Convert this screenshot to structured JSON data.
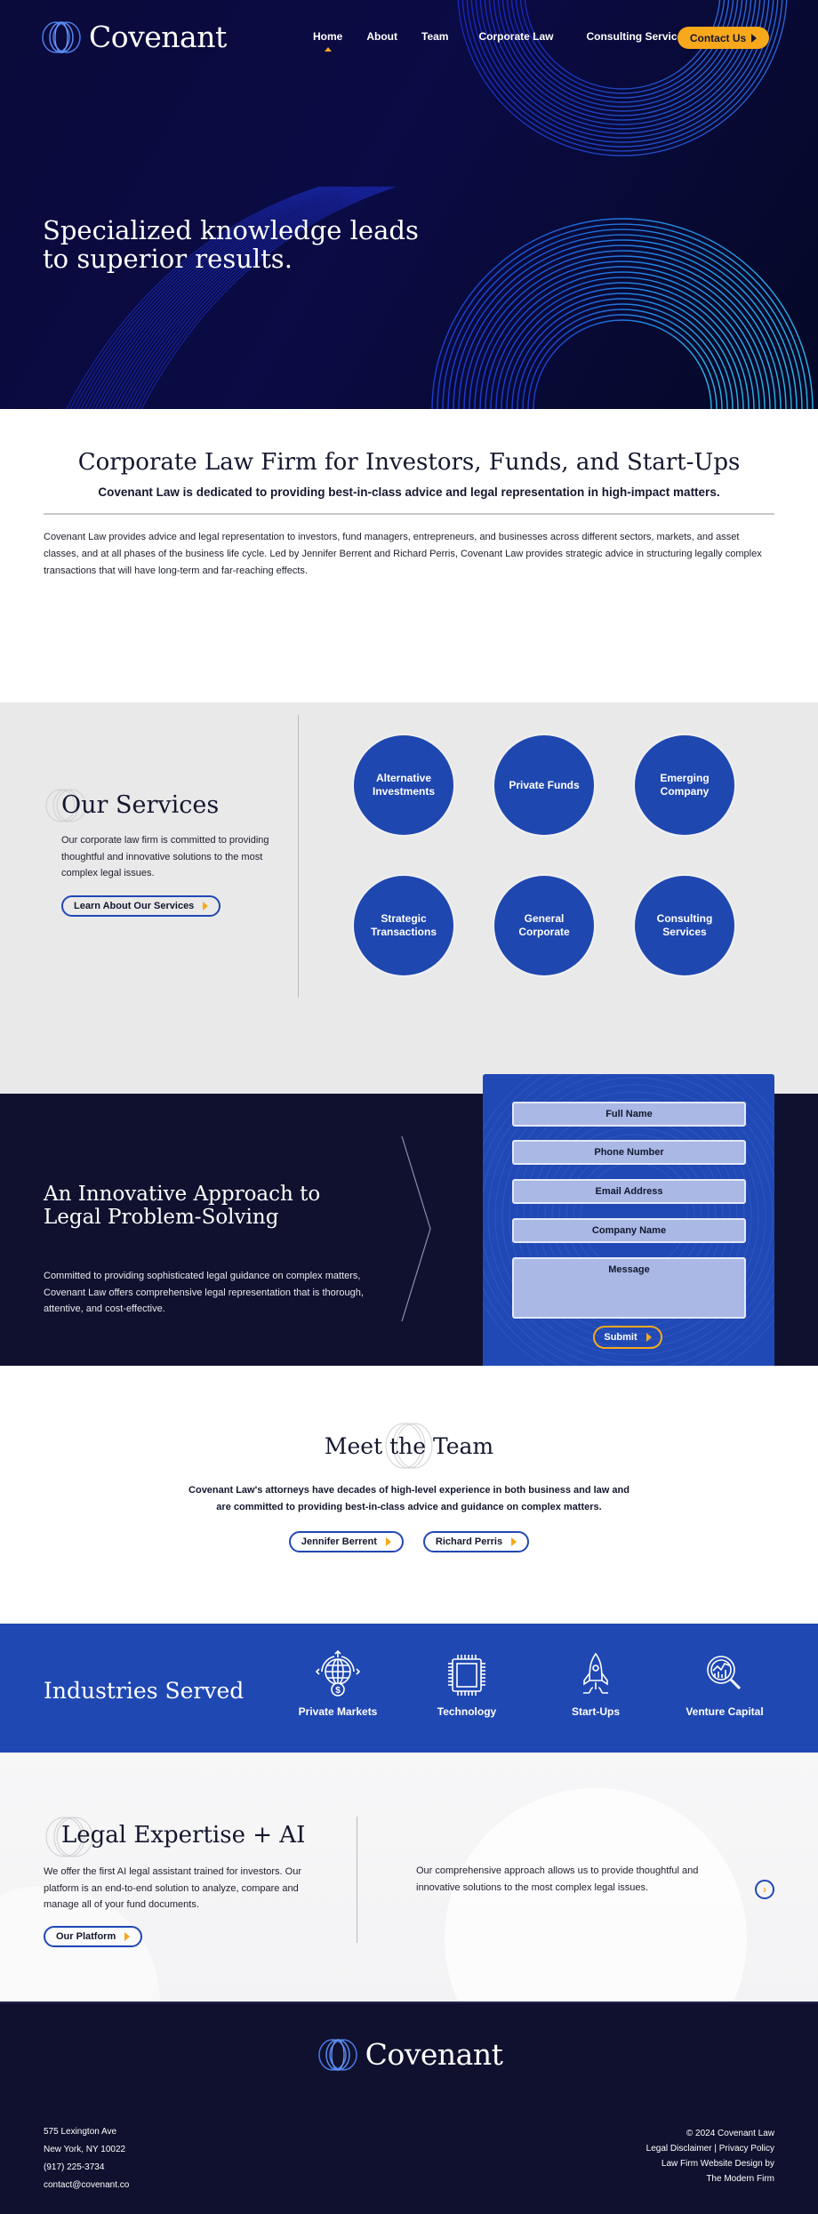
{
  "brand": {
    "name": "Covenant",
    "logo_icon": "interlocking-rings-icon",
    "colors": {
      "navy": "#10112e",
      "hero_navy": "#0a0a3a",
      "royal_blue": "#1f48b3",
      "accent_gold": "#f7a81b",
      "light_gray": "#e9e9ea"
    }
  },
  "nav": {
    "items": [
      {
        "label": "Home",
        "active": true
      },
      {
        "label": "About",
        "active": false
      },
      {
        "label": "Team",
        "active": false
      },
      {
        "label": "Corporate Law",
        "active": false
      },
      {
        "label": "Consulting Services",
        "active": false
      }
    ],
    "cta_label": "Contact Us"
  },
  "hero": {
    "headline_line1": "Specialized knowledge leads",
    "headline_line2": "to superior results."
  },
  "intro": {
    "title": "Corporate Law Firm for Investors, Funds, and Start-Ups",
    "subtitle": "Covenant Law is dedicated to providing best-in-class advice and legal representation in high-impact matters.",
    "body": "Covenant Law provides advice and legal representation to investors, fund managers, entrepreneurs, and businesses across different sectors, markets, and asset classes, and at all phases of the business life cycle. Led by Jennifer Berrent and Richard Perris, Covenant Law provides strategic advice in structuring legally complex transactions that will have long-term and far-reaching effects.",
    "scroll_icon": "chevron-down-icon"
  },
  "services": {
    "title": "Our Services",
    "description": "Our corporate law firm is committed to providing thoughtful and innovative solutions to the most complex legal issues.",
    "button_label": "Learn About Our Services",
    "items": [
      {
        "label": "Alternative Investments"
      },
      {
        "label": "Private Funds"
      },
      {
        "label": "Emerging Company"
      },
      {
        "label": "Strategic Transactions"
      },
      {
        "label": "General Corporate"
      },
      {
        "label": "Consulting Services"
      }
    ]
  },
  "approach": {
    "title_line1": "An Innovative Approach to",
    "title_line2": "Legal Problem-Solving",
    "body": "Committed to providing sophisticated legal guidance on complex matters, Covenant Law offers comprehensive legal representation that is thorough, attentive, and cost-effective."
  },
  "contact_form": {
    "fields": {
      "full_name": {
        "placeholder": "Full Name",
        "value": ""
      },
      "phone": {
        "placeholder": "Phone Number",
        "value": ""
      },
      "email": {
        "placeholder": "Email Address",
        "value": ""
      },
      "company": {
        "placeholder": "Company Name",
        "value": ""
      },
      "message": {
        "placeholder": "Message",
        "value": ""
      }
    },
    "submit_label": "Submit"
  },
  "team": {
    "title": "Meet the Team",
    "description": "Covenant Law's attorneys have decades of high-level experience in both business and law and are committed to providing best-in-class advice and guidance on complex matters.",
    "members": [
      {
        "name": "Jennifer Berrent"
      },
      {
        "name": "Richard Perris"
      }
    ]
  },
  "industries": {
    "title": "Industries Served",
    "items": [
      {
        "label": "Private Markets",
        "icon": "globe-dollar-icon"
      },
      {
        "label": "Technology",
        "icon": "microchip-icon"
      },
      {
        "label": "Start-Ups",
        "icon": "rocket-icon"
      },
      {
        "label": "Venture Capital",
        "icon": "magnifier-chart-icon"
      }
    ]
  },
  "ai": {
    "title": "Legal Expertise + AI",
    "left_body": "We offer the first AI legal assistant trained for investors. Our platform is an end-to-end solution to analyze, compare and manage all of your fund documents.",
    "button_label": "Our Platform",
    "right_body": "Our comprehensive approach allows us to provide thoughtful and innovative solutions to the most complex legal issues."
  },
  "footer": {
    "address_line1": "575 Lexington Ave",
    "address_line2": "New York, NY 10022",
    "phone": "(917) 225-3734",
    "email": "contact@covenant.co",
    "copyright": "© 2024 Covenant Law",
    "legal_disclaimer": "Legal Disclaimer",
    "separator": "|",
    "privacy_policy": "Privacy Policy",
    "credit_line1": "Law Firm Website Design by",
    "credit_line2": "The Modern Firm"
  }
}
